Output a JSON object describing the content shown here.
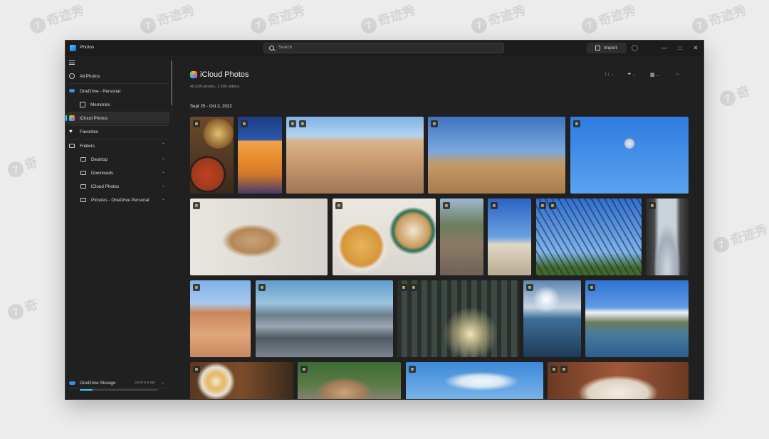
{
  "window": {
    "app_title": "Photos"
  },
  "search": {
    "placeholder": "Search"
  },
  "toolbar": {
    "import_label": "Import",
    "sort_icon": "↑↓",
    "filter_icon": "⏷",
    "view_icon": "▦",
    "more_icon": "···"
  },
  "sidebar": {
    "items": [
      {
        "label": "All Photos",
        "icon": "photos-icon"
      },
      {
        "label": "OneDrive - Personal",
        "icon": "cloud-icon"
      },
      {
        "label": "Memories",
        "icon": "memories-icon"
      },
      {
        "label": "iCloud Photos",
        "icon": "icloud-icon"
      },
      {
        "label": "Favorites",
        "icon": "heart-icon"
      },
      {
        "label": "Folders",
        "icon": "folder-icon"
      },
      {
        "label": "Desktop",
        "icon": "folder-icon"
      },
      {
        "label": "Downloads",
        "icon": "folder-icon"
      },
      {
        "label": "iCloud Photos",
        "icon": "folder-icon"
      },
      {
        "label": "Pictures - OneDrive Personal",
        "icon": "folder-icon"
      }
    ],
    "storage": {
      "label": "OneDrive Storage",
      "amount": "0.8 of 5.0 GB",
      "used_fraction": 0.16
    }
  },
  "main": {
    "title": "iCloud Photos",
    "subtitle": "40,639 photos, 1,399 videos",
    "date_group": "Sept 25 - Oct 3, 2022"
  },
  "colors": {
    "accent": "#4cc2ff",
    "background": "#202020",
    "sidebar_active": "#2d2d2d"
  },
  "photos": [
    {
      "subject": "food-bowls"
    },
    {
      "subject": "orange-wall-person"
    },
    {
      "subject": "desert-rocks"
    },
    {
      "subject": "joshua-tree"
    },
    {
      "subject": "swing-ride"
    },
    {
      "subject": "dog-on-chair"
    },
    {
      "subject": "toast-and-coffee"
    },
    {
      "subject": "dog-on-street"
    },
    {
      "subject": "bikes-at-beach"
    },
    {
      "subject": "eiffel-tower"
    },
    {
      "subject": "louvre-pyramid"
    },
    {
      "subject": "desert-canyon"
    },
    {
      "subject": "city-mountains"
    },
    {
      "subject": "forest-sunbeams"
    },
    {
      "subject": "rocky-shore"
    },
    {
      "subject": "lake-clouds"
    },
    {
      "subject": "breakfast-plates"
    },
    {
      "subject": "dog-outdoors"
    },
    {
      "subject": "sky-clouds"
    },
    {
      "subject": "dessert-plate"
    }
  ]
}
